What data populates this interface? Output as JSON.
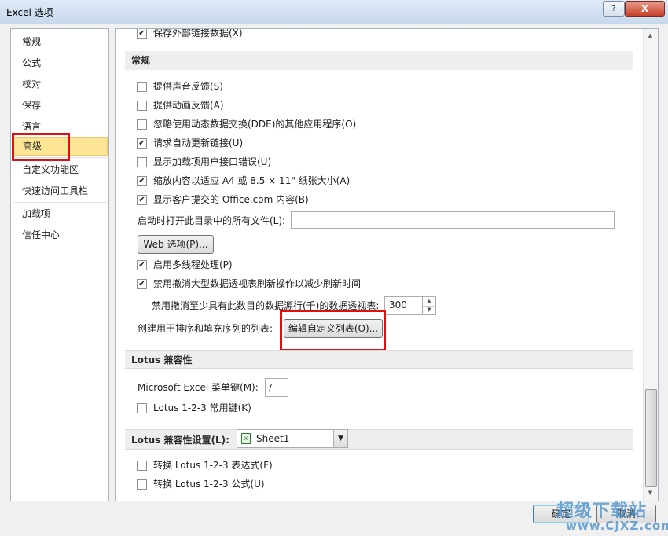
{
  "window": {
    "title": "Excel 选项",
    "help_label": "?",
    "close_label": "X"
  },
  "nav": {
    "items": [
      {
        "label": "常规"
      },
      {
        "label": "公式"
      },
      {
        "label": "校对"
      },
      {
        "label": "保存"
      },
      {
        "label": "语言"
      },
      {
        "label": "高级",
        "selected": true
      },
      {
        "label": "自定义功能区"
      },
      {
        "label": "快速访问工具栏"
      },
      {
        "label": "加载项"
      },
      {
        "label": "信任中心"
      }
    ]
  },
  "content": {
    "partial_top": {
      "label": "保存外部链接数据(X)",
      "checked": true
    },
    "general": {
      "header": "常规",
      "options": [
        {
          "label": "提供声音反馈(S)",
          "checked": false
        },
        {
          "label": "提供动画反馈(A)",
          "checked": false
        },
        {
          "label": "忽略使用动态数据交换(DDE)的其他应用程序(O)",
          "checked": false
        },
        {
          "label": "请求自动更新链接(U)",
          "checked": true
        },
        {
          "label": "显示加载项用户接口错误(U)",
          "checked": false
        },
        {
          "label": "缩放内容以适应 A4 或 8.5 × 11\" 纸张大小(A)",
          "checked": true
        },
        {
          "label": "显示客户提交的 Office.com 内容(B)",
          "checked": true
        }
      ],
      "startup_label": "启动时打开此目录中的所有文件(L):",
      "startup_value": "",
      "web_options_button": "Web 选项(P)...",
      "multithread_label": "启用多线程处理(P)",
      "multithread_checked": true,
      "disable_undo_label": "禁用撤消大型数据透视表刷新操作以减少刷新时间",
      "disable_undo_checked": true,
      "undo_rows_label": "禁用撤消至少具有此数目的数据源行(千)的数据透视表:",
      "undo_rows_value": "300",
      "custom_list_label": "创建用于排序和填充序列的列表:",
      "custom_list_button": "编辑自定义列表(O)..."
    },
    "lotus": {
      "header": "Lotus 兼容性",
      "menu_key_label": "Microsoft Excel 菜单键(M):",
      "menu_key_value": "/",
      "nav_keys_label": "Lotus 1-2-3 常用键(K)",
      "nav_keys_checked": false
    },
    "lotus_settings": {
      "header": "Lotus 兼容性设置(L):",
      "sheet_value": "Sheet1",
      "formula_eval_label": "转换 Lotus 1-2-3 表达式(F)",
      "formula_eval_checked": false,
      "formula_entry_label": "转换 Lotus 1-2-3 公式(U)",
      "formula_entry_checked": false
    }
  },
  "footer": {
    "ok_label": "确定",
    "cancel_label": "取消"
  },
  "watermark": {
    "line1": "超级下载站",
    "line2": "www.CJXZ.com"
  },
  "colors": {
    "selected_nav_bg": "#fce595",
    "highlight_border": "#e01010",
    "section_bg": "#eeeeee"
  },
  "icons": {
    "checkbox_checked": "✔",
    "spin_up": "▲",
    "spin_down": "▼",
    "dropdown": "▼",
    "sheet": "excel-sheet-icon"
  }
}
